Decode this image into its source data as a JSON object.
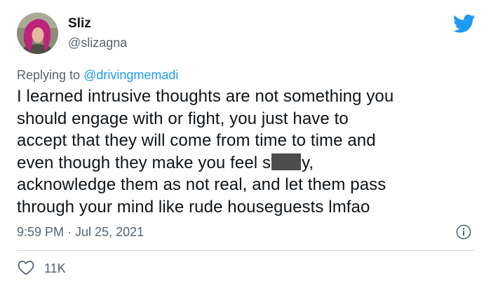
{
  "author": {
    "display_name": "Sliz",
    "handle": "@slizagna"
  },
  "reply": {
    "prefix": "Replying to ",
    "mention": "@drivingmemadi"
  },
  "tweet": {
    "line1": "I learned intrusive thoughts are not something you",
    "line2": "should engage with or fight, you just have to",
    "line3": "accept that they will come from time to time and",
    "line4_before": "even though they make you feel s",
    "line4_after": "y,",
    "line5": "acknowledge them as not real, and let them pass",
    "line6": "through your mind like rude houseguests lmfao"
  },
  "meta": {
    "timestamp": "9:59 PM · Jul 25, 2021"
  },
  "actions": {
    "like_count": "11K"
  },
  "icons": {
    "brand": "twitter-bird-icon",
    "info": "info-icon",
    "like": "heart-icon"
  },
  "colors": {
    "brand": "#1d9bf0",
    "secondary_text": "#536471",
    "censor_bar": "#4d4d4d"
  }
}
